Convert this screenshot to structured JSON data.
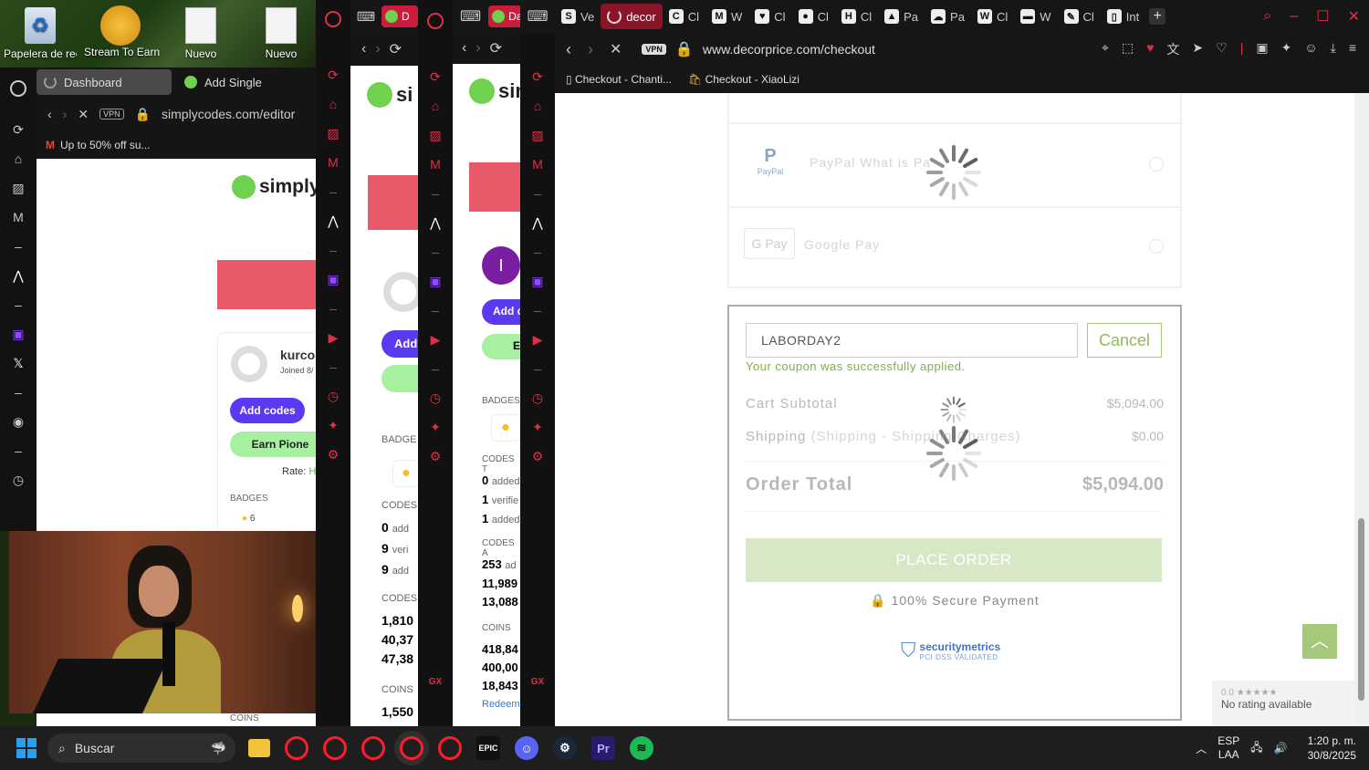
{
  "desktop": {
    "icons": [
      {
        "label": "Papelera de reciclaje",
        "icon": "recycle-bin-icon"
      },
      {
        "label": "Stream To Earn",
        "icon": "stream-to-earn-icon"
      },
      {
        "label": "Nuevo",
        "icon": "document-icon"
      },
      {
        "label": "Nuevo",
        "icon": "document-icon"
      }
    ]
  },
  "window1": {
    "tabs": [
      {
        "label": "Dashboard"
      },
      {
        "label": "Add Single"
      }
    ],
    "address": "simplycodes.com/editor",
    "vpn": "VPN",
    "bookmark": "Up to 50% off su...",
    "logo": "simplyc",
    "profile": {
      "name": "kurco",
      "joined": "Joined 8/"
    },
    "add_codes": "Add codes",
    "earn": "Earn Pione",
    "rate": "Rate:",
    "rate_val": "H",
    "badges": "BADGES",
    "badge_count": "6",
    "coins": "COINS"
  },
  "window2": {
    "tab": "D",
    "logo": "si",
    "add": "Add",
    "badges": "BADGE",
    "codes1": "CODES",
    "stats1": [
      {
        "n": "0",
        "t": "add"
      },
      {
        "n": "9",
        "t": "veri"
      },
      {
        "n": "9",
        "t": "add"
      }
    ],
    "codes2": "CODES",
    "stats2": [
      "1,810",
      "40,37",
      "47,38"
    ],
    "coins": "COINS",
    "coins_val": "1,550"
  },
  "window3": {
    "tab": "Da",
    "logo": "sim",
    "avatar": "I",
    "add": "Add c",
    "e": "E",
    "badges": "BADGES",
    "codes_t": "CODES T",
    "stats1": [
      {
        "n": "0",
        "t": "added"
      },
      {
        "n": "1",
        "t": "verifie"
      },
      {
        "n": "1",
        "t": "added"
      }
    ],
    "codes_a": "CODES A",
    "stats2": [
      {
        "n": "253",
        "t": "ad"
      },
      {
        "n": "11,989",
        "t": ""
      },
      {
        "n": "13,088",
        "t": ""
      }
    ],
    "coins": "COINS",
    "coins_vals": [
      "418,84",
      "400,00",
      "18,843"
    ],
    "redeem": "Redeem",
    "gx": "GX"
  },
  "main": {
    "gx": "GX",
    "tabs": [
      {
        "label": "Ve",
        "fav": "S"
      },
      {
        "label": "decor",
        "fav": "",
        "active": true
      },
      {
        "label": "Cl",
        "fav": "C"
      },
      {
        "label": "W",
        "fav": "M"
      },
      {
        "label": "Cl",
        "fav": "♥"
      },
      {
        "label": "Cl",
        "fav": "●"
      },
      {
        "label": "Cl",
        "fav": "H"
      },
      {
        "label": "Pa",
        "fav": "▲"
      },
      {
        "label": "Pa",
        "fav": "☁"
      },
      {
        "label": "Cl",
        "fav": "W"
      },
      {
        "label": "W",
        "fav": "▬"
      },
      {
        "label": "Cl",
        "fav": "✎"
      },
      {
        "label": "Int",
        "fav": "▯"
      }
    ],
    "address": "www.decorprice.com/checkout",
    "vpn": "VPN",
    "bookmarks": [
      {
        "label": "Checkout - Chanti..."
      },
      {
        "label": "Checkout - XiaoLizi"
      }
    ]
  },
  "checkout": {
    "paypal_label": "PayPal",
    "paypal_text": "PayPal  What is Pa",
    "gpay_logo": "G Pay",
    "gpay_text": "Google Pay",
    "coupon_value": "LABORDAY2",
    "cancel": "Cancel",
    "coupon_msg": "Your coupon was successfully applied.",
    "subtotal_label": "Cart Subtotal",
    "subtotal_value": "$5,094.00",
    "shipping_label": "Shipping",
    "shipping_detail": "(Shipping - Shipping Charges)",
    "shipping_value": "$0.00",
    "total_label": "Order Total",
    "total_value": "$5,094.00",
    "place_order": "PLACE ORDER",
    "secure": "100% Secure Payment",
    "secmetrics": "securitymetrics",
    "secmetrics_sub": "PCI DSS VALIDATED",
    "rating_score": "0.0",
    "rating_text": "No rating available"
  },
  "taskbar": {
    "search": "Buscar",
    "lang1": "ESP",
    "lang2": "LAA",
    "time": "1:20 p. m.",
    "date": "30/8/2025",
    "colors": {
      "accent": "#0078d4",
      "opera": "#ff1b2d",
      "spotify": "#1db954",
      "discord": "#5865f2",
      "premiere": "#2a1b6e"
    }
  }
}
